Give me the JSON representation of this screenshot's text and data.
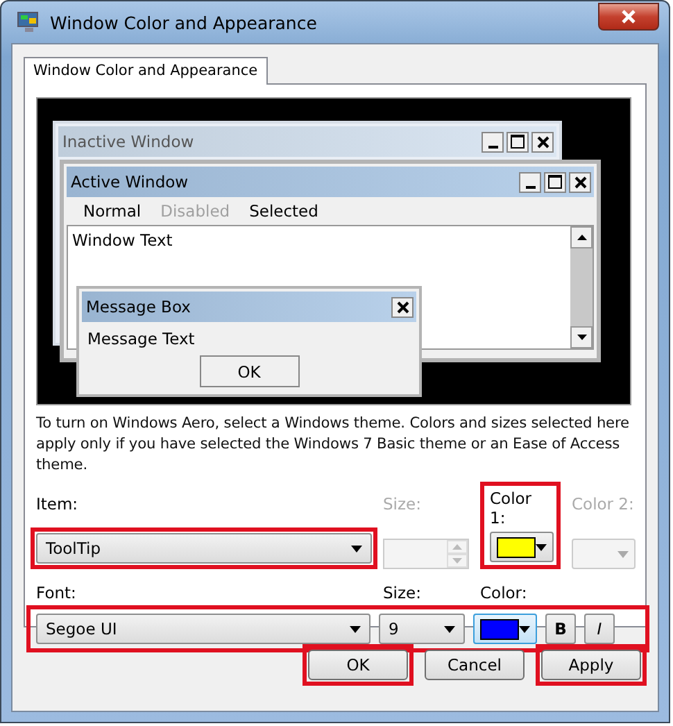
{
  "window": {
    "title": "Window Color and Appearance"
  },
  "tabs": [
    {
      "label": "Window Color and Appearance",
      "selected": true
    }
  ],
  "preview": {
    "inactive_window": {
      "title": "Inactive Window"
    },
    "active_window": {
      "title": "Active Window",
      "text": "Window Text",
      "menu": [
        {
          "label": "Normal",
          "disabled": false
        },
        {
          "label": "Disabled",
          "disabled": true
        },
        {
          "label": "Selected",
          "disabled": false
        }
      ]
    },
    "message_box": {
      "title": "Message Box",
      "text": "Message Text",
      "button": "OK"
    }
  },
  "description": "To turn on Windows Aero, select a Windows theme.  Colors and sizes selected here apply only if you have selected the Windows 7 Basic theme or an Ease of Access theme.",
  "item": {
    "label": "Item:",
    "value": "ToolTip",
    "highlighted": true
  },
  "item_size": {
    "label": "Size:",
    "disabled": true
  },
  "color_1": {
    "label": "Color 1:",
    "color": "#ffff00",
    "highlighted": true
  },
  "color_2": {
    "label": "Color 2:",
    "disabled": true
  },
  "font_row": {
    "highlighted": true
  },
  "font": {
    "label": "Font:",
    "value": "Segoe UI"
  },
  "font_size": {
    "label": "Size:",
    "value": "9"
  },
  "font_color": {
    "label": "Color:",
    "color": "#0000ff"
  },
  "bold": {
    "label": "B"
  },
  "italic": {
    "label": "I"
  },
  "buttons": [
    {
      "label": "OK",
      "highlighted": true
    },
    {
      "label": "Cancel",
      "highlighted": false
    },
    {
      "label": "Apply",
      "highlighted": true
    }
  ]
}
